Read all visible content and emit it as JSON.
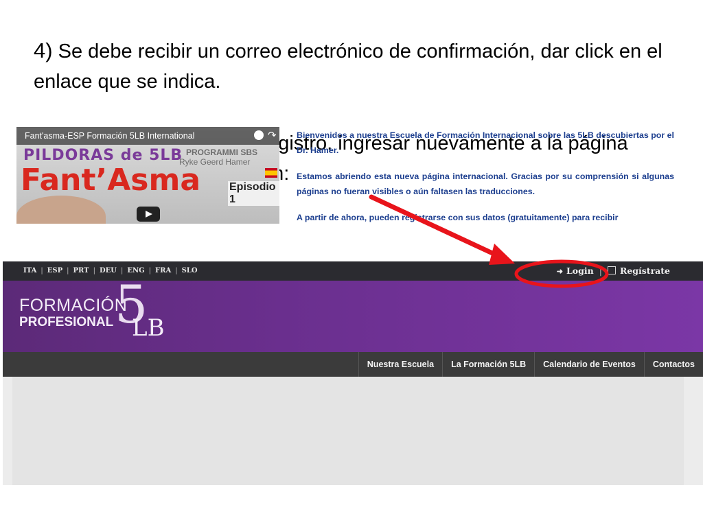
{
  "slide": {
    "step4_number": "4)",
    "step4_text": " Se debe recibir un correo electrónico de confirmación, dar click en el enlace que se indica.",
    "step5_text": "5) Una vez confirmado el registro, ingresar nuevamente a la página principal y dar click en Login:"
  },
  "site": {
    "languages": [
      "ITA",
      "ESP",
      "PRT",
      "DEU",
      "ENG",
      "FRA",
      "SLO"
    ],
    "auth": {
      "login": "Login",
      "register": "Regístrate"
    },
    "logo": {
      "line1": "FORMACIÓN",
      "line2": "PROFESIONAL",
      "mark_number": "5",
      "mark_letters": "LB"
    },
    "nav": [
      "Nuestra Escuela",
      "La Formación 5LB",
      "Calendario de Eventos",
      "Contactos"
    ],
    "video": {
      "title": "Fant'asma-ESP Formación 5LB International",
      "headline": "PILDORAS de 5LB",
      "programmi": "PROGRAMMI SBS",
      "author": "Ryke Geerd Hamer",
      "big_title": "Fant’Asma",
      "episode": "Episodio 1"
    },
    "welcome": {
      "p1": "Bienvenidos a nuestra Escuela de Formación Internacional sobre las 5LB descubiertas por el Dr. Hamer.",
      "p2": "Estamos abriendo esta nueva página internacional. Gracias por su comprensión si algunas páginas no fueran visibles o aún faltasen las traducciones.",
      "p3": "A partir de ahora, pueden registrarse con sus datos (gratuitamente) para recibir"
    }
  },
  "colors": {
    "banner_purple": "#6a2f8e",
    "topbar_dark": "#2b2b30",
    "navbar_dark": "#3b3b3b",
    "welcome_blue": "#1d3f8f",
    "annotation_red": "#e8141b"
  },
  "icons": {
    "login": "sign-in-icon",
    "register": "edit-icon",
    "arrow": "red-arrow",
    "highlight": "red-ellipse"
  }
}
